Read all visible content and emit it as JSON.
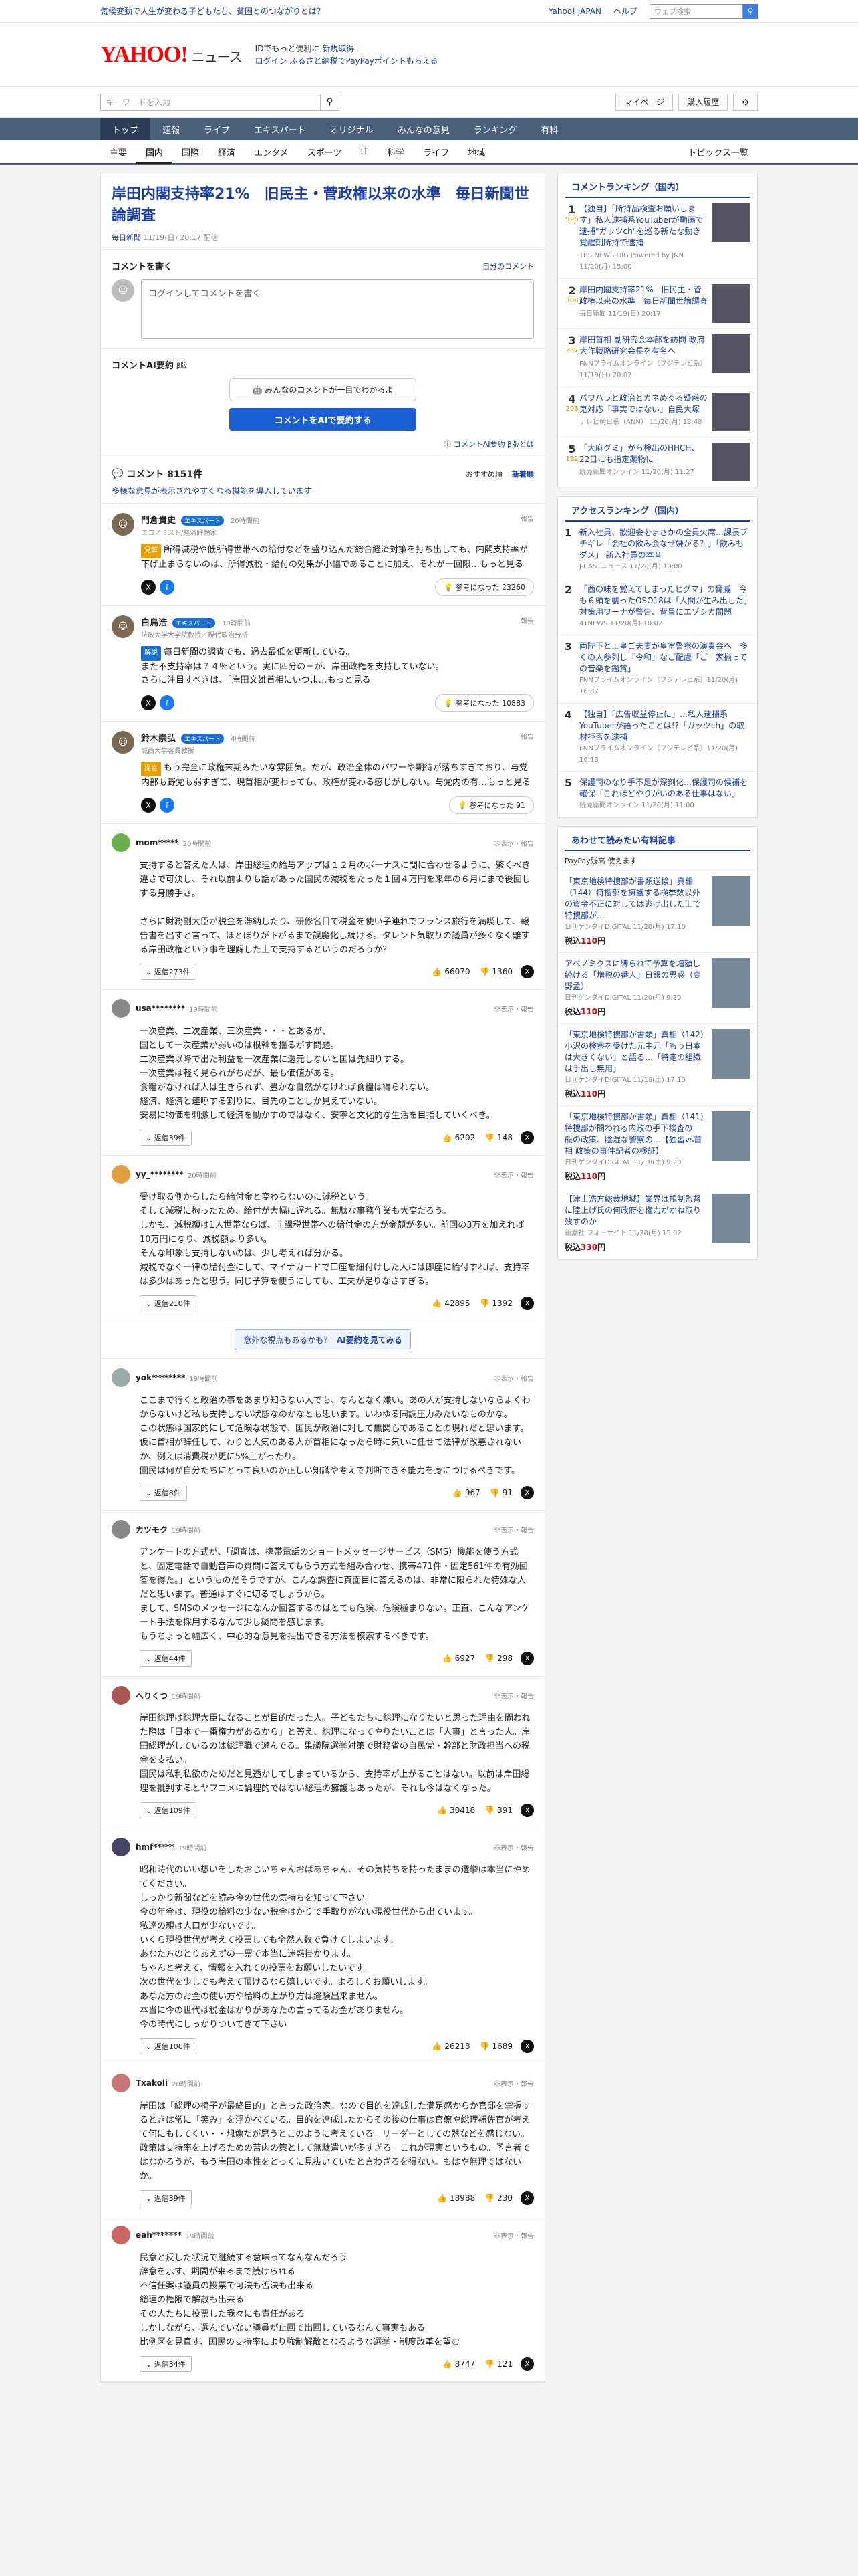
{
  "topbar": {
    "promo": "気候変動で人生が変わる子どもたち、貧困とのつながりとは？",
    "links": [
      "Yahoo! JAPAN",
      "ヘルプ"
    ],
    "search_placeholder": "ウェブ検索"
  },
  "header": {
    "logo": "YAHOO!",
    "logo_sub": "JAPAN",
    "service": "ニュース",
    "tag1": "IDでもっと便利に",
    "tag1b": "新規取得",
    "tag2": "ログイン",
    "tag2b": "ふるさと納税でPayPayポイントもらえる"
  },
  "tools": {
    "search_placeholder": "キーワードを入力",
    "mypage": "マイページ",
    "purchased": "購入履歴"
  },
  "nav1": [
    "トップ",
    "速報",
    "ライブ",
    "エキスパート",
    "オリジナル",
    "みんなの意見",
    "ランキング",
    "有料"
  ],
  "nav2": [
    "主要",
    "国内",
    "国際",
    "経済",
    "エンタメ",
    "スポーツ",
    "IT",
    "科学",
    "ライフ",
    "地域"
  ],
  "nav2_right": "トピックス一覧",
  "article": {
    "title": "岸田内閣支持率21%　旧民主・菅政権以来の水準　毎日新聞世論調査",
    "source": "毎日新聞",
    "date": "11/19(日) 20:17 配信"
  },
  "write": {
    "title": "コメントを書く",
    "link": "自分のコメント",
    "placeholder": "ログインしてコメントを書く"
  },
  "ai": {
    "title": "コメントAI要約",
    "beta": "β版",
    "card": "みんなのコメントが一目でわかるよ",
    "button": "コメントをAIで要約する",
    "footer": "コメントAI要約 β版とは"
  },
  "count": {
    "label": "コメント",
    "value": "8151件",
    "sort1": "おすすめ順",
    "sort2": "新着順",
    "note": "多様な意見が表示されやすくなる機能を導入しています"
  },
  "experts": [
    {
      "name": "門倉貴史",
      "badge": "エキスパート",
      "time": "20時間前",
      "org": "エコノミスト/経済評論家",
      "label": "見解",
      "label_color": "#e8a000",
      "text": "所得減税や低所得世帯への給付などを盛り込んだ総合経済対策を打ち出しても、内閣支持率が下げ止まらないのは、所得減税・給付の効果が小幅であることに加え、それが一回限…もっと見る",
      "help": "参考になった 23260"
    },
    {
      "name": "白鳥浩",
      "badge": "エキスパート",
      "time": "19時間前",
      "org": "法政大学大学院教授／現代政治分析",
      "label": "解説",
      "label_color": "#1a6fd6",
      "text": "毎日新聞の調査でも、過去最低を更新している。\nまた不支持率は７４％という。実に四分の三が、岸田政権を支持していない。\nさらに注目すべきは、「岸田文雄首相にいつま…もっと見る",
      "help": "参考になった 10883"
    },
    {
      "name": "鈴木崇弘",
      "badge": "エキスパート",
      "time": "4時間前",
      "org": "城西大学客員教授",
      "label": "提言",
      "label_color": "#e8a000",
      "text": "もう完全に政権末期みたいな雰囲気。だが、政治全体のパワーや期待が落ちすぎており、与党内部も野党も弱すぎて、現首相が変わっても、政権が変わる感じがしない。与党内の有…もっと見る",
      "help": "参考になった 91"
    }
  ],
  "comments": [
    {
      "name": "mom*****",
      "time": "20時間前",
      "text": "支持すると答えた人は、岸田総理の給与アップは１２月のボーナスに間に合わせるように、繁くべき違さで可決し、それ以前よりも話があった国民の減税をたった１回４万円を来年の６月にまで後回しする身勝手さ。\n\nさらに財務副大臣が税金を滞納したり、研修名目で税金を使い子連れでフランス旅行を満喫して、報告書を出すと言って、ほとぼりが下がるまで誤魔化し続ける。タレント気取りの議員が多くなく離する岸田政権という事を理解した上で支持するというのだろうか？",
      "replies": "返信273件",
      "up": "66070",
      "down": "1360"
    },
    {
      "name": "usa********",
      "time": "19時間前",
      "text": "一次産業、二次産業、三次産業・・・とあるが、\n国として一次産業が弱いのは根幹を揺るがす問題。\n二次産業以降で出た利益を一次産業に還元しないと国は先細りする。\n一次産業は軽く見られがちだが、最も価値がある。\n食糧がなければ人は生きられず、豊かな自然がなければ食糧は得られない。\n経済、経済と連呼する割りに、目先のことしか見えていない。\n安易に物価を刺激して経済を動かすのではなく、安寧と文化的な生活を目指していくべき。",
      "replies": "返信39件",
      "up": "6202",
      "down": "148"
    },
    {
      "name": "yy_********",
      "time": "20時間前",
      "text": "受け取る側からしたら給付金と変わらないのに減税という。\nそして減税に拘ったため、給付が大幅に遅れる。無駄な事務作業も大変だろう。\nしかも、減税額は1人世帯ならば、非課税世帯への給付金の方が金額が多い。前回の3万を加えれば10万円になり、減税額より多い。\nそんな印象も支持しないのは、少し考えれば分かる。\n減税でなく一律の給付金にして、マイナカードで口座を紐付けした人には即座に給付すれば、支持率は多少はあったと思う。同じ予算を使うにしても、工夫が足りなさすぎる。",
      "replies": "返信210件",
      "up": "42895",
      "down": "1392"
    },
    {
      "name": "yok********",
      "time": "19時間前",
      "text": "ここまで行くと政治の事をあまり知らない人でも、なんとなく嫌い。あの人が支持しないならよくわからないけど私も支持しない状態なのかなとも思います。いわゆる同調圧力みたいなものかな。\nこの状態は国家的にして危険な状態で、国民が政治に対して無関心であることの現れだと思います。\n仮に首相が辞任して、わりと人気のある人が首相になったら時に気いに任せて法律が改悪されないか、例えば消費税が更に5%上がったり。\n国民は何が自分たちにとって良いのか正しい知識や考えで判断できる能力を身につけるべきです。",
      "replies": "返信8件",
      "up": "967",
      "down": "91"
    },
    {
      "name": "カツモク",
      "time": "19時間前",
      "text": "アンケートの方式が、「調査は、携帯電話のショートメッセージサービス（SMS）機能を使う方式と、固定電話で自動音声の質問に答えてもらう方式を組み合わせ、携帯471件・固定561件の有効回答を得た。」というものだそうですが、こんな調査に真面目に答えるのは、非常に限られた特殊な人だと思います。普通はすぐに切るでしょうから。\nまして、SMSのメッセージになんか回答するのはとても危険、危険極まりない。正直、こんなアンケート手法を採用するなんて少し疑問を感じます。\nもうちょっと幅広く、中心的な意見を抽出できる方法を模索するべきです。",
      "replies": "返信44件",
      "up": "6927",
      "down": "298"
    },
    {
      "name": "へりくつ",
      "time": "19時間前",
      "text": "岸田総理は総理大臣になることが目的だった人。子どもたちに総理になりたいと思った理由を問われた際は「日本で一番権力があるから」と答え、総理になってやりたいことは「人事」と言った人。岸田総理がしているのは総理職で遊んでる。果議院選挙対策で財務省の自民党・幹部と財政担当への税金を支払い。\n国民は私利私欲のためだと見透かしてしまっているから、支持率が上がることはない。以前は岸田総理を批判するとヤフコメに論理的ではない総理の擁護もあったが、それも今はなくなった。",
      "replies": "返信109件",
      "up": "30418",
      "down": "391"
    },
    {
      "name": "hmf*****",
      "time": "19時間前",
      "text": "昭和時代のいい想いをしたおじいちゃんおばあちゃん、その気持ちを持ったままの選挙は本当にやめてください。\nしっかり新聞などを読み今の世代の気持ちを知って下さい。\n今の年金は、現役の給料の少ない税金はかりで手取りがない現役世代から出ています。\n私達の親は人口が少ないです。\nいくら現役世代が考えて投票しても全然人数で負けてしまいます。\nあなた方のとりあえずの一票で本当に迷惑掛かります。\nちゃんと考えて、情報を入れての投票をお願いしたいです。\n次の世代を少しでも考えて頂けるなら嬉しいです。よろしくお願いします。\nあなた方のお金の使い方や給料の上がり方は経験出来ません。\n本当に今の世代は税金はかりがあなたの言ってるお金がありません。\n今の時代にしっかりついてきて下さい",
      "replies": "返信106件",
      "up": "26218",
      "down": "1689"
    },
    {
      "name": "Txakoli",
      "time": "20時間前",
      "text": "岸田は「総理の椅子が最終目的」と言った政治家。なので目的を達成した満足感からか官邸を掌握するときは常に「笑み」を浮かべている。目的を達成したからその後の仕事は官僚や総理補佐官が考えて何にもしてくい・・想像だが思うとこのように考えている。リーダーとしての器などを感じない。\n政策は支持率を上げるための苦肉の策として無駄遣いが多すぎる。これが現実というもの。予言者ではなかろうが、もう岸田の本性をとっくに見抜いていたと言わざるを得ない。もはや無理ではないか。",
      "replies": "返信39件",
      "up": "18988",
      "down": "230"
    },
    {
      "name": "eah*******",
      "time": "19時間前",
      "text": "民意と反した状況で継続する意味ってなんなんだろう\n辞意を示す、期間が来るまで続けられる\n不信任案は議員の投票で可決も否決も出来る\n総理の権限で解散も出来る\nその人たちに投票した我々にも責任がある\nしかしながら、選んでいない議員が止回で出回しているなんて事実もある\n比例区を見直す、国民の支持率により強制解散となるような選挙・制度改革を望む",
      "replies": "返信34件",
      "up": "8747",
      "down": "121"
    }
  ],
  "ai_bar": {
    "text": "意外な視点もあるかも？",
    "button": "AI要約を見てみる"
  },
  "sidebar": {
    "ranking_title": "コメントランキング（国内）",
    "ranking": [
      {
        "n": "1",
        "c": "928",
        "text": "【独自】「所持品検査お願いします」私人逮捕系YouTuberが動画で逮捕\"ガッツch\"を巡る新たな動き　覚醒剤所持で逮捕",
        "meta": "TBS NEWS DIG Powered by JNN 11/20(月) 15:00"
      },
      {
        "n": "2",
        "c": "308",
        "text": "岸田内閣支持率21%　旧民主・菅政権以来の水準　毎日新聞世論調査",
        "meta": "毎日新聞 11/19(日) 20:17"
      },
      {
        "n": "3",
        "c": "237",
        "text": "岸田首相 副研究会本部を訪問 政府大作戦略研究会長を有名へ",
        "meta": "FNNプライムオンライン（フジテレビ系）11/19(日) 20:02"
      },
      {
        "n": "4",
        "c": "206",
        "text": "パワハラと政治とカネめぐる疑惑の鬼対応「事実ではない」自民大塚",
        "meta": "テレビ朝日系（ANN） 11/20(月) 13:48"
      },
      {
        "n": "5",
        "c": "182",
        "text": "「大麻グミ」から検出のHHCH、22日にも指定薬物に",
        "meta": "読売新聞オンライン 11/20(月) 11:27"
      }
    ],
    "access_title": "アクセスランキング（国内）",
    "access": [
      {
        "n": "1",
        "text": "新入社員、歓迎会をまさかの全員欠席…課長ブチギレ「会社の飲み会なぜ嫌がる？」「飲みもダメ」  新入社員の本音",
        "meta": "J-CASTニュース 11/20(月) 10:00"
      },
      {
        "n": "2",
        "text": "「西の味を覚えてしまったヒグマ」の脅威　今も６頭を襲ったOSO18は「人間が生み出した」対策用ワーナが警告、背景にエゾシカ問題",
        "meta": "4TNEWS 11/20(月) 10:02"
      },
      {
        "n": "3",
        "text": "両陛下と上皇ご夫妻が皇室警察の演奏会へ　多くの人参列し「今和」なご配慮「ご一家揃っての音楽を鑑賞」",
        "meta": "FNNプライムオンライン（フジテレビ系）11/20(月) 16:37"
      },
      {
        "n": "4",
        "text": "【独自】「広告収益停止に」…私人逮捕系YouTuberが語ったことは!?「ガッツch」の取材拒否を逮捕",
        "meta": "FNNプライムオンライン（フジテレビ系）11/20(月) 16:13"
      },
      {
        "n": "5",
        "text": "保護司のなり手不足が深刻化…保護司の候補を確保「これほどやりがいのある仕事はない」",
        "meta": "読売新聞オンライン 11/20(月) 11:00"
      }
    ],
    "books_title": "あわせて読みたい有料記事",
    "books_sub": "PayPay残高 使えます",
    "books": [
      {
        "text": "「東京地検特捜部が書類送検」真相（144）特捜部を擁護する検挙数以外の資金不正に対しては逃げ出した上で特捜部が…",
        "meta": "日刊ゲンダイDIGITAL 11/20(月) 17:10",
        "price": "110"
      },
      {
        "text": "アベノミクスに縛られて予算を増額し続ける「増税の番人」日銀の思惑（高野孟）",
        "meta": "日刊ゲンダイDIGITAL 11/20(月) 9:20",
        "price": "110"
      },
      {
        "text": "「東京地検特捜部が書類」真相（142）小沢の検察を受けた元中元「もう日本は大きくない」と語る…「特定の組織は手出し無用」",
        "meta": "日刊ゲンダイDIGITAL 11/18(土) 17:10",
        "price": "110"
      },
      {
        "text": "「東京地検特捜部が書類」真相（141）特捜部が問われる内政の手下検査の一般の政策、陰湿な警察の…【独習vs首相 政策の事件記者の検証】",
        "meta": "日刊ゲンダイDIGITAL 11/18(土) 9:20",
        "price": "110"
      },
      {
        "text": "【津上浩方総裁地域】業界は規制監督に陸上げ氏の何政府を権力がかね取り残すのか",
        "meta": "新潮社 フォーサイト 11/20(月) 15:02",
        "price": "330"
      }
    ]
  }
}
